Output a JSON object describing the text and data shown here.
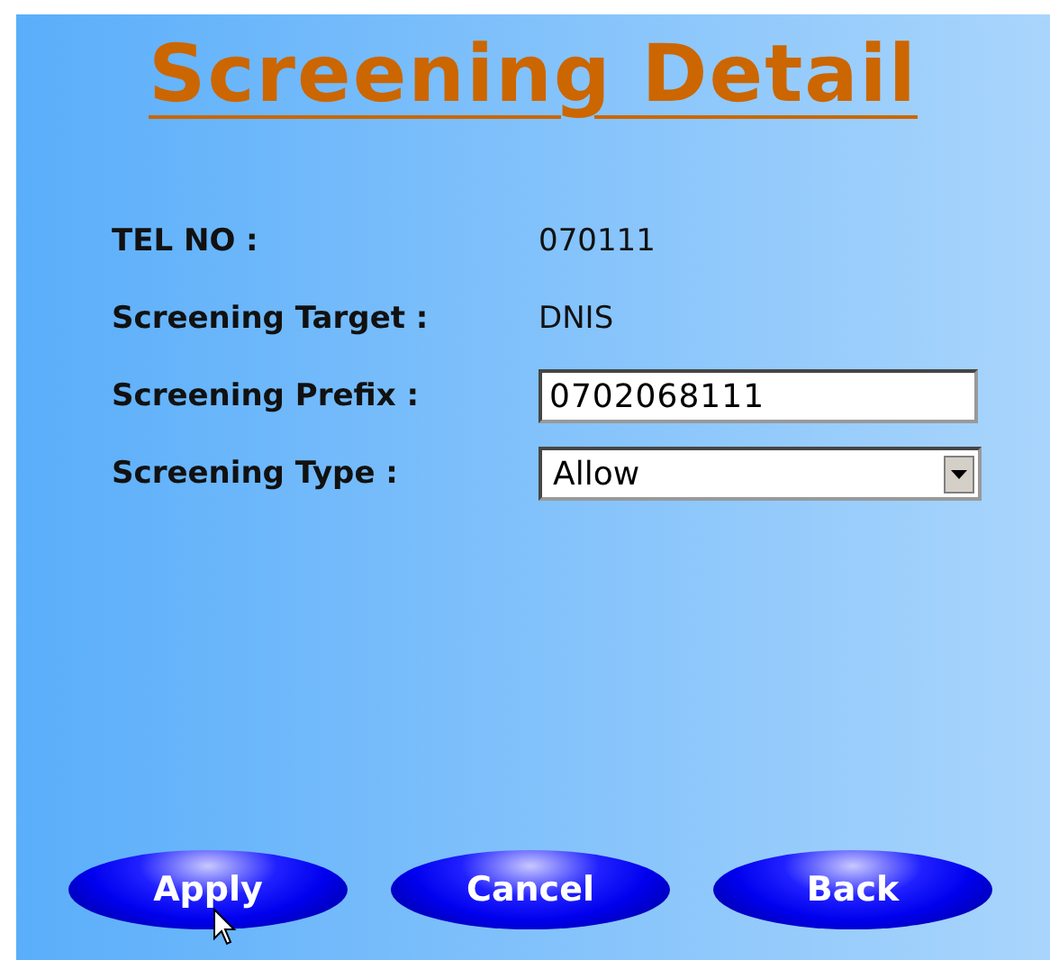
{
  "title": "Screening Detail",
  "fields": [
    {
      "kind": "text",
      "label": "TEL NO :",
      "value": "070111"
    },
    {
      "kind": "text",
      "label": "Screening Target :",
      "value": "DNIS"
    },
    {
      "kind": "input",
      "label": "Screening Prefix :",
      "value": "0702068111"
    },
    {
      "kind": "select",
      "label": "Screening Type :",
      "value": "Allow"
    }
  ],
  "buttons": [
    "Apply",
    "Cancel",
    "Back"
  ]
}
